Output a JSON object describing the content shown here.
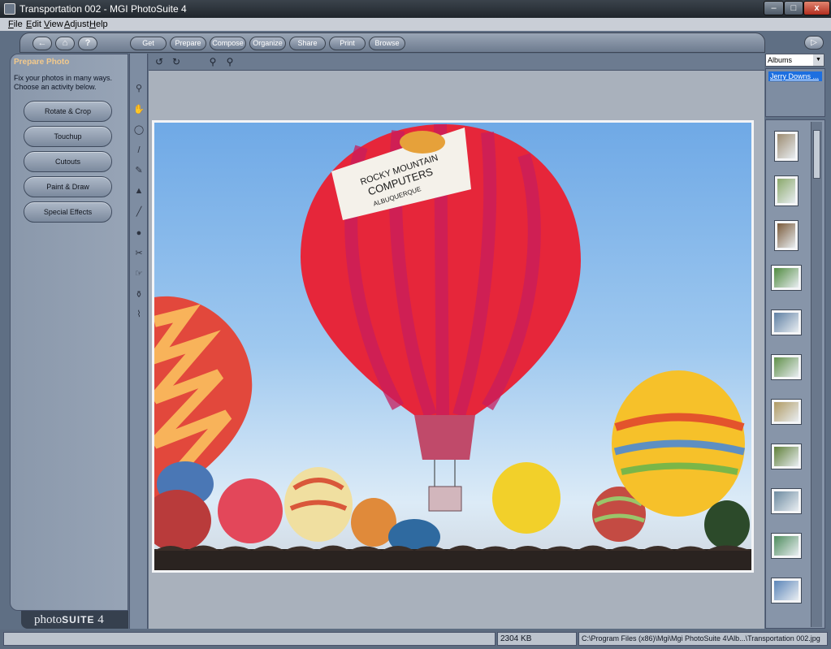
{
  "window": {
    "title": "Transportation 002 - MGI PhotoSuite 4",
    "minimize_glyph": "–",
    "maximize_glyph": "□",
    "close_glyph": "x"
  },
  "menu": [
    "File",
    "Edit",
    "View",
    "Adjust",
    "Help"
  ],
  "toolbar": {
    "icons": [
      "back-icon",
      "home-icon",
      "help-icon"
    ],
    "back_glyph": "←",
    "home_glyph": "⌂",
    "help_glyph": "?",
    "forward_glyph": "▷",
    "nav": [
      "Get",
      "Prepare",
      "Compose",
      "Organize",
      "Share",
      "Print",
      "Browse"
    ]
  },
  "left_panel": {
    "title": "Prepare Photo",
    "desc_line1": "Fix your photos in many ways.",
    "desc_line2": "Choose an activity below.",
    "activities": [
      "Rotate & Crop",
      "Touchup",
      "Cutouts",
      "Paint & Draw",
      "Special Effects"
    ],
    "logo_light": "photo",
    "logo_bold": "SUITE",
    "logo_version": "4"
  },
  "tools": [
    {
      "name": "zoom-tool-icon",
      "glyph": "⚲"
    },
    {
      "name": "pan-hand-icon",
      "glyph": "✋"
    },
    {
      "name": "lasso-icon",
      "glyph": "◯"
    },
    {
      "name": "brush-icon",
      "glyph": "/"
    },
    {
      "name": "pencil-icon",
      "glyph": "✎"
    },
    {
      "name": "stamp-icon",
      "glyph": "▲"
    },
    {
      "name": "line-icon",
      "glyph": "╱"
    },
    {
      "name": "ellipse-icon",
      "glyph": "●"
    },
    {
      "name": "scissors-icon",
      "glyph": "✂"
    },
    {
      "name": "smudge-icon",
      "glyph": "☞"
    },
    {
      "name": "dropper-icon",
      "glyph": "⚱"
    },
    {
      "name": "eraser-icon",
      "glyph": "⌇"
    }
  ],
  "canvas_tools": [
    {
      "name": "rotate-left-icon",
      "glyph": "↺"
    },
    {
      "name": "rotate-right-icon",
      "glyph": "↻"
    },
    {
      "name": "zoom-in-icon",
      "glyph": "⚲"
    },
    {
      "name": "zoom-out-icon",
      "glyph": "⚲"
    }
  ],
  "photo": {
    "banner_line1": "ROCKY MOUNTAIN",
    "banner_line2": "COMPUTERS",
    "banner_line3": "ALBUQUERQUE"
  },
  "albums": {
    "selected": "Albums",
    "arrow": "▼",
    "current_album": "Jerry Downs ...",
    "thumbnail_colors": [
      "#9c8b70",
      "#8aa86a",
      "#7a5a3a",
      "#4f8a3e",
      "#5e7fa3",
      "#5f8f48",
      "#b09a62",
      "#5f7f38",
      "#6c8aa0",
      "#4d8c5c",
      "#5a84b8"
    ]
  },
  "status": {
    "size": "2304 KB",
    "path": "C:\\Program Files (x86)\\Mgi\\Mgi PhotoSuite 4\\Alb...\\Transportation 002.jpg"
  }
}
